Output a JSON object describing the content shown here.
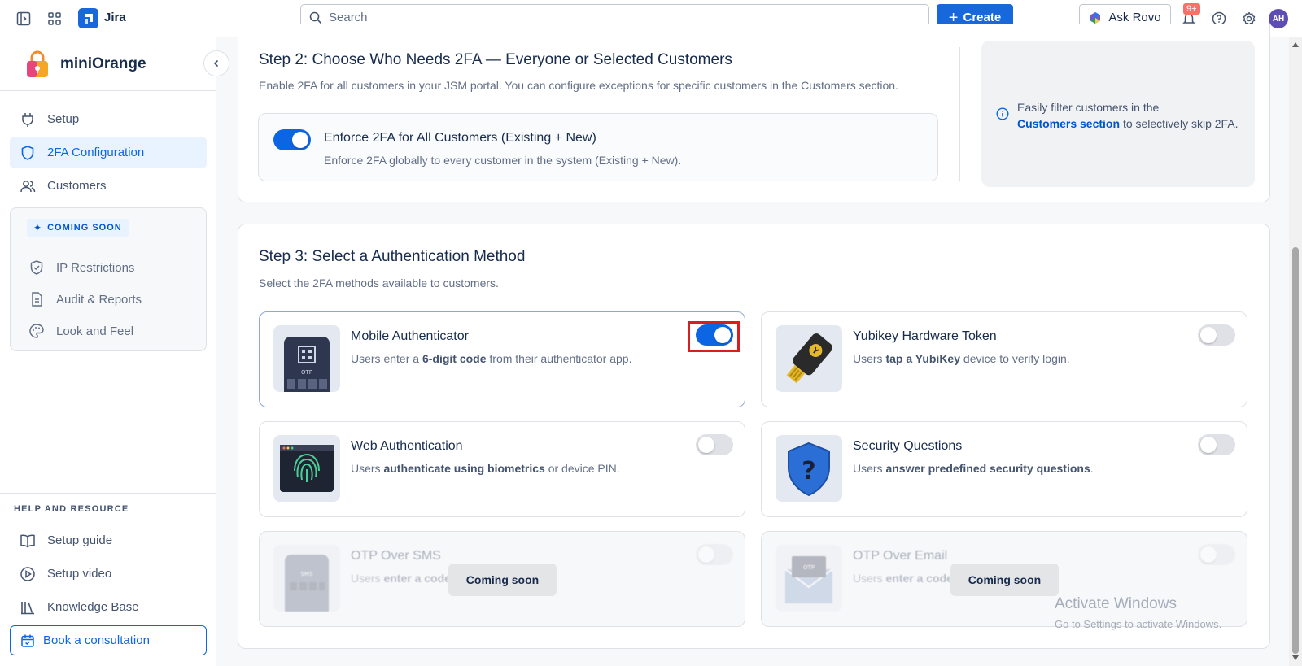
{
  "topbar": {
    "app_name": "Jira",
    "search_placeholder": "Search",
    "create_label": "Create",
    "ask_rovo_label": "Ask Rovo",
    "notification_count": "9+",
    "avatar_initials": "AH"
  },
  "sidebar": {
    "brand_name": "miniOrange",
    "nav": [
      {
        "label": "Setup",
        "icon": "plug-icon",
        "active": false
      },
      {
        "label": "2FA Configuration",
        "icon": "shield-icon",
        "active": true
      },
      {
        "label": "Customers",
        "icon": "users-icon",
        "active": false
      }
    ],
    "coming_soon": {
      "tag": "COMING SOON",
      "items": [
        {
          "label": "IP Restrictions",
          "icon": "shield-check-icon"
        },
        {
          "label": "Audit & Reports",
          "icon": "document-icon"
        },
        {
          "label": "Look and Feel",
          "icon": "palette-icon"
        }
      ]
    },
    "help": {
      "title": "HELP AND RESOURCE",
      "items": [
        {
          "label": "Setup guide",
          "icon": "book-open-icon"
        },
        {
          "label": "Setup video",
          "icon": "play-circle-icon"
        },
        {
          "label": "Knowledge Base",
          "icon": "library-icon"
        }
      ],
      "consult_label": "Book a consultation"
    }
  },
  "step2": {
    "title": "Step 2: Choose Who Needs 2FA — Everyone or Selected Customers",
    "subtitle": "Enable 2FA for all customers in your JSM portal. You can configure exceptions for specific customers in the Customers section.",
    "enforce_title": "Enforce 2FA for All Customers (Existing + New)",
    "enforce_desc": "Enforce 2FA globally to every customer in the system (Existing + New).",
    "enforce_on": true,
    "info_text_1": "Easily filter customers in the",
    "info_link": "Customers section",
    "info_text_2": "to selectively skip 2FA."
  },
  "step3": {
    "title": "Step 3: Select a Authentication Method",
    "subtitle": "Select the 2FA methods available to customers.",
    "methods": [
      {
        "title": "Mobile Authenticator",
        "desc_pre": "Users enter a ",
        "desc_bold": "6-digit code",
        "desc_post": " from their authenticator app.",
        "enabled": true
      },
      {
        "title": "Yubikey Hardware Token",
        "desc_pre": "Users ",
        "desc_bold": "tap a YubiKey",
        "desc_post": " device to verify login.",
        "enabled": false
      },
      {
        "title": "Web Authentication",
        "desc_pre": "Users ",
        "desc_bold": "authenticate using biometrics",
        "desc_post": " or device PIN.",
        "enabled": false
      },
      {
        "title": "Security Questions",
        "desc_pre": "Users ",
        "desc_bold": "answer predefined security questions",
        "desc_post": ".",
        "enabled": false
      },
      {
        "title": "OTP Over SMS",
        "desc_pre": "Users ",
        "desc_bold": "enter a code",
        "desc_post": "",
        "enabled": false,
        "coming_soon": "Coming soon"
      },
      {
        "title": "OTP Over Email",
        "desc_pre": "Users ",
        "desc_bold": "enter a code",
        "desc_post": "",
        "enabled": false,
        "coming_soon": "Coming soon"
      }
    ]
  },
  "watermark": {
    "line1": "Activate Windows",
    "line2": "Go to Settings to activate Windows."
  },
  "colors": {
    "primary": "#0c66e4",
    "highlight": "#d61f1f",
    "badge": "#f87168"
  }
}
